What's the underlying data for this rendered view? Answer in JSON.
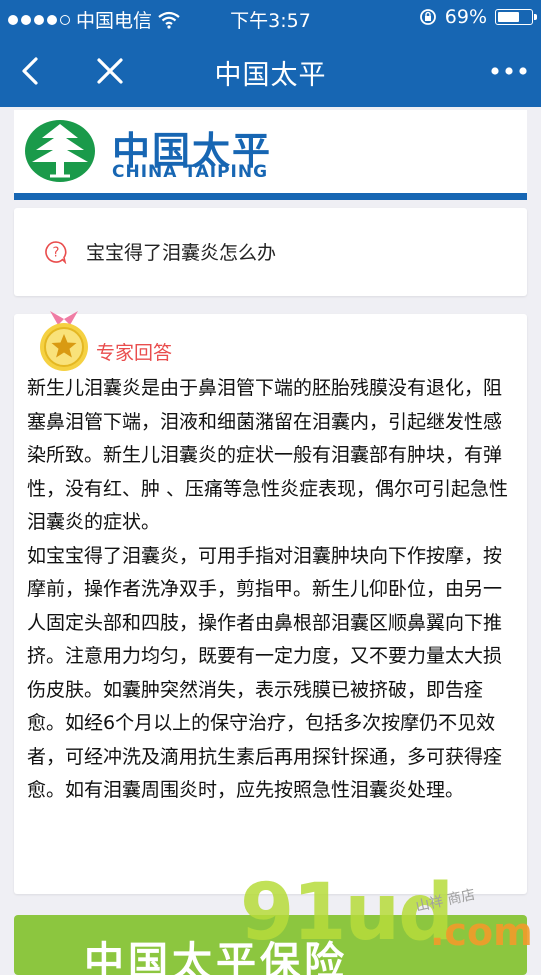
{
  "status_bar": {
    "carrier": "中国电信",
    "time": "下午3:57",
    "battery_percent": "69%",
    "battery_level": 0.69
  },
  "nav": {
    "title": "中国太平",
    "back_icon": "chevron-left-icon",
    "close_icon": "close-icon",
    "more_icon": "more-dots-icon"
  },
  "logo": {
    "name_cn": "中国太平",
    "name_en": "CHINA TAIPING"
  },
  "question": {
    "text": "宝宝得了泪囊炎怎么办"
  },
  "answer": {
    "label": "专家回答",
    "paragraphs": [
      "新生儿泪囊炎是由于鼻泪管下端的胚胎残膜没有退化，阻塞鼻泪管下端，泪液和细菌潴留在泪囊内，引起继发性感染所致。新生儿泪囊炎的症状一般有泪囊部有肿块，有弹性，没有红、肿 、压痛等急性炎症表现，偶尔可引起急性泪囊炎的症状。",
      "如宝宝得了泪囊炎，可用手指对泪囊肿块向下作按摩，按摩前，操作者洗净双手，剪指甲。新生儿仰卧位，由另一人固定头部和四肢，操作者由鼻根部泪囊区顺鼻翼向下推挤。注意用力均匀，既要有一定力度，又不要力量太大损伤皮肤。如囊肿突然消失，表示残膜已被挤破，即告痊愈。如经6个月以上的保守治疗，包括多次按摩仍不见效者，可经冲洗及滴用抗生素后再用探针探通，多可获得痊愈。如有泪囊周围炎时，应先按照急性泪囊炎处理。"
    ]
  },
  "banner": {
    "text": "中国太平保险"
  },
  "watermark": {
    "main": "91ud",
    "suffix": ".com",
    "sign": "山祥 商店"
  },
  "colors": {
    "brand_blue": "#1766b3",
    "expert_red": "#e94d4d",
    "banner_green": "#8cc63f"
  }
}
